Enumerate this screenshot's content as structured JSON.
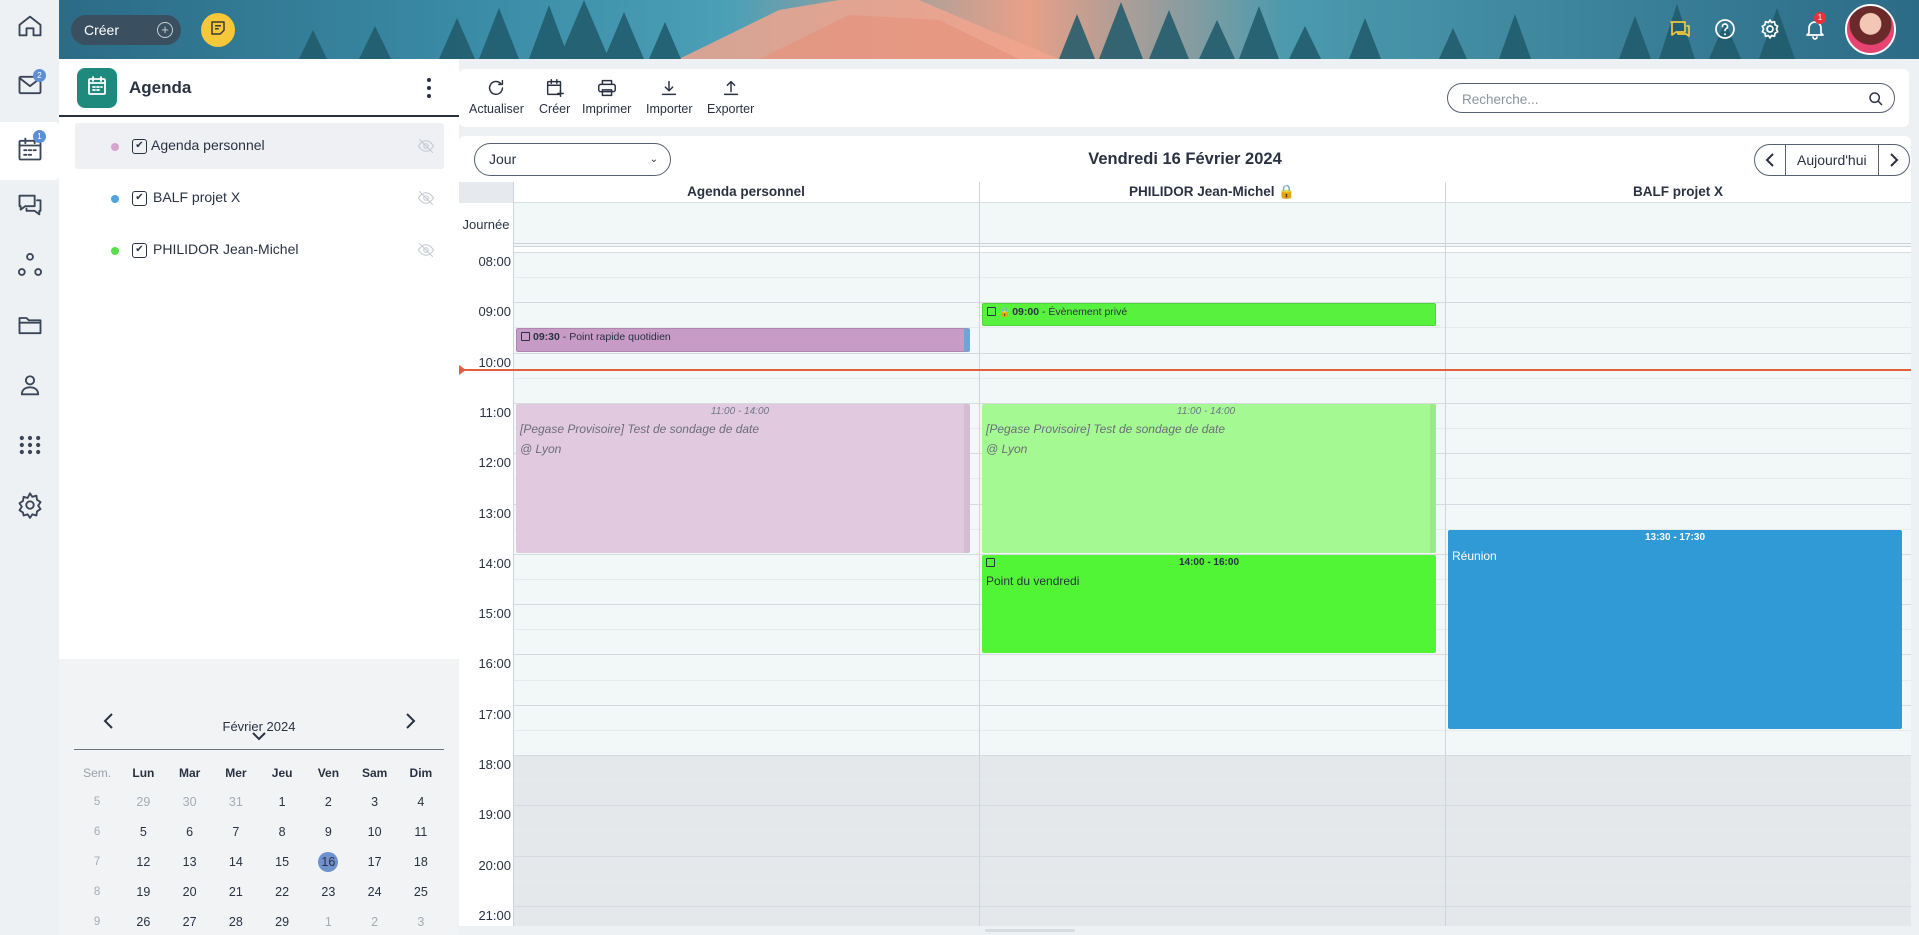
{
  "rail": {
    "items": [
      {
        "name": "home-icon",
        "badge": ""
      },
      {
        "name": "mail-icon",
        "badge": "2"
      },
      {
        "name": "calendar-icon",
        "badge": "1"
      },
      {
        "name": "chat-icon",
        "badge": ""
      },
      {
        "name": "network-icon",
        "badge": ""
      },
      {
        "name": "folder-icon",
        "badge": ""
      },
      {
        "name": "contacts-icon",
        "badge": ""
      },
      {
        "name": "apps-grid-icon",
        "badge": ""
      },
      {
        "name": "settings-icon",
        "badge": ""
      }
    ]
  },
  "topbar": {
    "create_label": "Créer",
    "notification_count": "1"
  },
  "left_panel": {
    "title": "Agenda",
    "agendas": [
      {
        "label": "Agenda personnel",
        "color": "#d4a6cf",
        "checked": "✔"
      },
      {
        "label": "BALF projet X",
        "color": "#4ea3e0",
        "checked": "✔"
      },
      {
        "label": "PHILIDOR Jean-Michel",
        "color": "#55e04b",
        "checked": "✔"
      }
    ],
    "mini_calendar": {
      "month": "Février 2024",
      "headers": [
        "Sem.",
        "Lun",
        "Mar",
        "Mer",
        "Jeu",
        "Ven",
        "Sam",
        "Dim"
      ],
      "weeks": [
        [
          "5",
          "29",
          "30",
          "31",
          "1",
          "2",
          "3",
          "4"
        ],
        [
          "6",
          "5",
          "6",
          "7",
          "8",
          "9",
          "10",
          "11"
        ],
        [
          "7",
          "12",
          "13",
          "14",
          "15",
          "16",
          "17",
          "18"
        ],
        [
          "8",
          "19",
          "20",
          "21",
          "22",
          "23",
          "24",
          "25"
        ],
        [
          "9",
          "26",
          "27",
          "28",
          "29",
          "1",
          "2",
          "3"
        ]
      ],
      "today": "16"
    }
  },
  "toolbar": {
    "actions": [
      {
        "label": "Actualiser",
        "icon": "refresh-icon"
      },
      {
        "label": "Créer",
        "icon": "calendar-add-icon"
      },
      {
        "label": "Imprimer",
        "icon": "printer-icon"
      },
      {
        "label": "Importer",
        "icon": "import-icon"
      },
      {
        "label": "Exporter",
        "icon": "export-icon"
      }
    ],
    "search_placeholder": "Recherche..."
  },
  "calendar": {
    "view": "Jour",
    "date_title": "Vendredi 16 Février 2024",
    "today_label": "Aujourd'hui",
    "allday_label": "Journée",
    "columns": [
      {
        "label": "Agenda personnel"
      },
      {
        "label": "PHILIDOR Jean-Michel 🔒"
      },
      {
        "label": "BALF projet X"
      }
    ],
    "hours": [
      "08:00",
      "09:00",
      "10:00",
      "11:00",
      "12:00",
      "13:00",
      "14:00",
      "15:00",
      "16:00",
      "17:00",
      "18:00",
      "19:00",
      "20:00",
      "21:00"
    ],
    "now": "10:20",
    "events": [
      {
        "col": 1,
        "start": "09:00",
        "end": "09:30",
        "time": "09:00",
        "title": "- Évènement privé",
        "color": "#58f13e",
        "style": "solid",
        "private": true
      },
      {
        "col": 0,
        "start": "09:30",
        "end": "10:00",
        "time": "09:30",
        "title": "- Point rapide quotidien",
        "color": "#c89ac6",
        "style": "solid",
        "private": false
      },
      {
        "col": 0,
        "start": "11:00",
        "end": "14:00",
        "time": "11:00 - 14:00",
        "title": "[Pegase Provisoire] Test de sondage de date",
        "location": "@ Lyon",
        "color": "#e1c9e0",
        "style": "tentative"
      },
      {
        "col": 1,
        "start": "11:00",
        "end": "14:00",
        "time": "11:00 - 14:00",
        "title": "[Pegase Provisoire] Test de sondage de date",
        "location": "@ Lyon",
        "color": "#a5f993",
        "style": "tentative"
      },
      {
        "col": 1,
        "start": "14:00",
        "end": "16:00",
        "time": "14:00 - 16:00",
        "title": "Point du vendredi",
        "color": "#52f536",
        "style": "block"
      },
      {
        "col": 2,
        "start": "13:30",
        "end": "17:30",
        "time": "13:30 - 17:30",
        "title": "Réunion",
        "color": "#2f9ad6",
        "style": "block"
      }
    ]
  }
}
